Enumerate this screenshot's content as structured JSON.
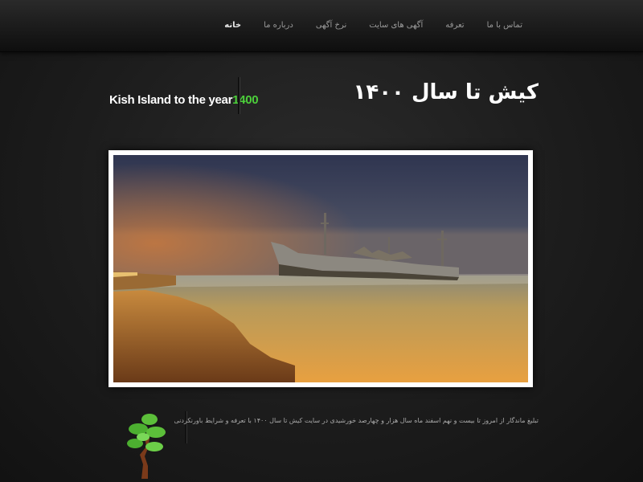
{
  "nav": {
    "items": [
      {
        "label": "خانه",
        "active": true
      },
      {
        "label": "درباره ما",
        "active": false
      },
      {
        "label": "نرخ آگهی",
        "active": false
      },
      {
        "label": "آگهی های سایت",
        "active": false
      },
      {
        "label": "تعرفه",
        "active": false
      },
      {
        "label": "تماس با ما",
        "active": false
      }
    ]
  },
  "brand": {
    "text": "Kish Island to the year",
    "year": "1400",
    "year_color": "#4ccf3a"
  },
  "header": {
    "title": "کیش تا سال ۱۴۰۰"
  },
  "hero": {
    "icon": "shipwreck-photo"
  },
  "footer": {
    "tree_icon": "bonsai-tree-icon",
    "description": "تبلیغ ماندگار از امروز تا بیست و نهم اسفند ماه سال هزار و چهارصد خورشیدی در سایت کیش تا سال ۱۴۰۰ با تعرفه و شرایط باورنکردنی"
  }
}
